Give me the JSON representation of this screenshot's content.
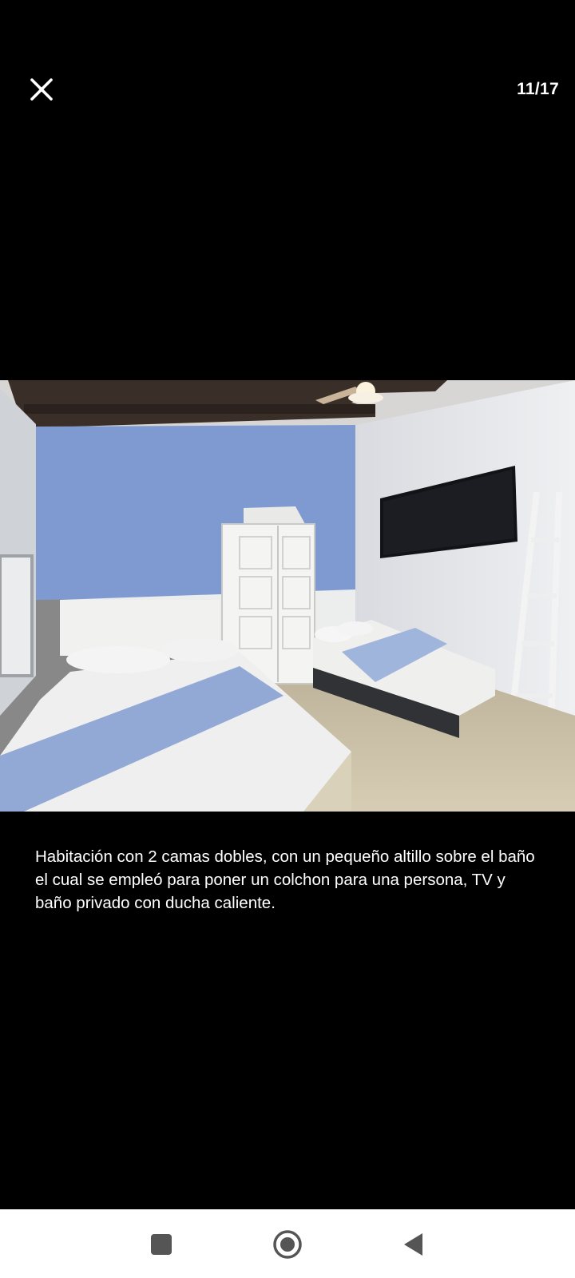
{
  "viewer": {
    "counter": "11/17",
    "close_icon": "close-icon"
  },
  "photo": {
    "subject": "bedroom-photo"
  },
  "caption": {
    "text": "Habitación con 2 camas dobles,  con un pequeño altillo sobre el baño el cual se empleó para poner un colchon para una persona, TV y baño privado con ducha caliente."
  },
  "navbar": {
    "recents_icon": "square-icon",
    "home_icon": "home-circle-icon",
    "back_icon": "back-triangle-icon",
    "background": "#ffffff",
    "icon_color": "#555555"
  },
  "colors": {
    "background": "#000000",
    "text": "#ffffff",
    "wall_blue": "#7f9ad0"
  }
}
